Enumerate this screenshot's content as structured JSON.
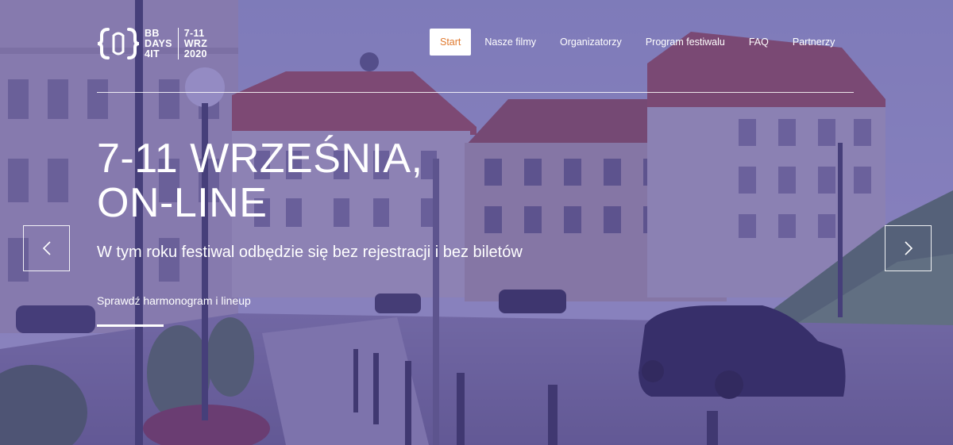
{
  "logo": {
    "line1": "BB",
    "line2": "DAYS",
    "line3": "4IT",
    "date1": "7-11",
    "date2": "WRZ",
    "date3": "2020"
  },
  "nav": {
    "items": [
      {
        "label": "Start",
        "active": true
      },
      {
        "label": "Nasze filmy",
        "active": false
      },
      {
        "label": "Organizatorzy",
        "active": false
      },
      {
        "label": "Program festiwalu",
        "active": false
      },
      {
        "label": "FAQ",
        "active": false
      },
      {
        "label": "Partnerzy",
        "active": false
      }
    ]
  },
  "hero": {
    "title_line1": "7-11 WRZEŚNIA,",
    "title_line2": "ON-LINE",
    "subtitle": "W tym roku festiwal odbędzie się bez rejestracji i bez biletów",
    "link": "Sprawdź harmonogram i lineup"
  },
  "carousel": {
    "prev_icon": "chevron-left-icon",
    "next_icon": "chevron-right-icon"
  },
  "colors": {
    "overlay": "#4e40a0",
    "accent": "#e07a2f",
    "text": "#ffffff"
  }
}
